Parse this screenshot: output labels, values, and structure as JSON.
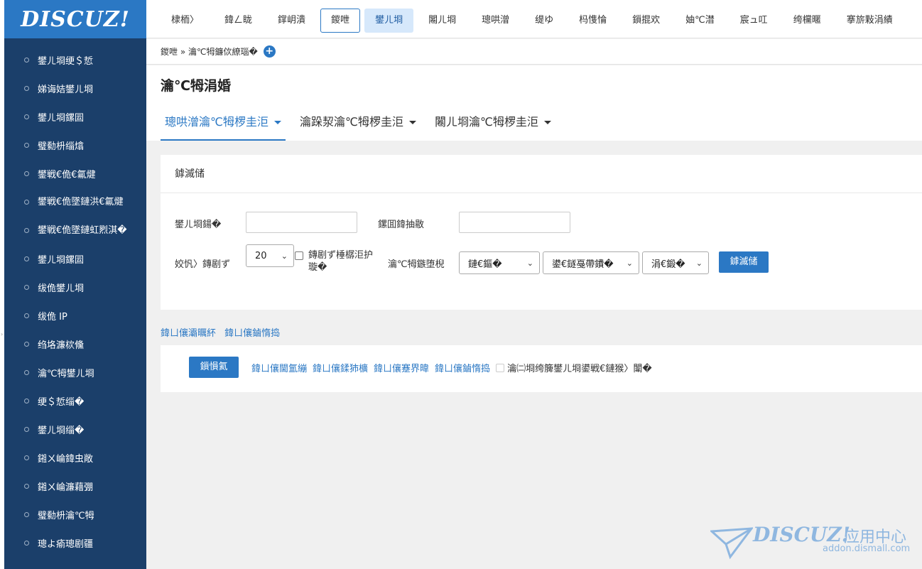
{
  "logo": {
    "text": "DISCUZ!"
  },
  "sidebar": {
    "items": [
      {
        "label": "鐢ㄦ埛绠＄悊"
      },
      {
        "label": "娣诲姞鐢ㄦ埛"
      },
      {
        "label": "鐢ㄦ埛鏍囩"
      },
      {
        "label": "璧勬枡缁熻"
      },
      {
        "label": "鐢戦€佹€氱煡"
      },
      {
        "label": "鐢戦€佹墜鏈洪€氱煡"
      },
      {
        "label": "鐢戦€佹墜鏈虹煭淇�"
      },
      {
        "label": "鐢ㄦ埛鏍囩"
      },
      {
        "label": "绂佹鐢ㄦ埛"
      },
      {
        "label": "绂佹 IP"
      },
      {
        "label": "绉垎濂栨儵"
      },
      {
        "label": "瀹℃牳鐢ㄦ埛"
      },
      {
        "label": "绠＄悊缁�"
      },
      {
        "label": "鐢ㄦ埛缁�"
      },
      {
        "label": "鎺ㄨ崘鍏虫敞"
      },
      {
        "label": "鎺ㄨ崘濂藉弸"
      },
      {
        "label": "璧勬枡瀹℃牳"
      },
      {
        "label": "璁よ瘉璁剧疆"
      }
    ]
  },
  "topnav": {
    "items": [
      {
        "label": "棣栭〉"
      },
      {
        "label": "鍏ㄥ眬"
      },
      {
        "label": "鐣岄潰"
      },
      {
        "label": "鍐呭"
      },
      {
        "label": "鐢ㄦ埛"
      },
      {
        "label": "闂ㄦ埛"
      },
      {
        "label": "璁哄潧"
      },
      {
        "label": "缇ゆ"
      },
      {
        "label": "杩愯惀"
      },
      {
        "label": "鎻掍欢"
      },
      {
        "label": "妯℃澘"
      },
      {
        "label": "宸ュ叿"
      },
      {
        "label": "绔欓暱"
      },
      {
        "label": "搴旂敤涓績"
      }
    ]
  },
  "breadcrumb": {
    "text": "鍐呭 » 瀹℃牳鐮佽繚瑙�"
  },
  "page": {
    "title": "瀹℃牳涓婚",
    "tabs": [
      {
        "label": "璁哄潧瀹℃牳椤圭洰"
      },
      {
        "label": "瀹跺洯瀹℃牳椤圭洰"
      },
      {
        "label": "闂ㄦ埛瀹℃牳椤圭洰"
      }
    ]
  },
  "filter": {
    "heading": "鎼滅储",
    "username_label": "鐢ㄦ埛鍚�",
    "keyword_label": "鏍囬鍏抽敭",
    "perpage_label": "姣忛〉鏄剧ず",
    "perpage_value": "20",
    "checkbox_label": "鏄剧ず棰樼洰护璇�",
    "time_label": "瀹℃牳鏃堕棿",
    "select1": "鏈€鏂�",
    "select2": "鍙€鐩戞帶鐨�",
    "select3": "涓€鍛�",
    "search_button": "鎼滅储"
  },
  "links": [
    {
      "label": "鍏ㄩ儴灞曞紑"
    },
    {
      "label": "鍏ㄩ儴鏀惰捣"
    }
  ],
  "actions": {
    "process_button": "鎻愪氦",
    "links": [
      {
        "label": "鍏ㄩ儴閫氳繃"
      },
      {
        "label": "鍏ㄩ儴鍒犻櫎"
      },
      {
        "label": "鍏ㄩ儴蹇界暐"
      },
      {
        "label": "鍏ㄩ儴鏀惰捣"
      }
    ],
    "checkbox_label": "瀹㈡埛绔簲鐢ㄦ埛鍙戦€鏈猴〉闈�"
  },
  "watermark": {
    "brand": "DISCUZ!",
    "cn": "应用中心",
    "sub": "addon.dismall.com"
  },
  "colors": {
    "sidebar": "#1b3f6a",
    "accent": "#2b78c4",
    "active_tab_bg": "#d6e8fb"
  }
}
